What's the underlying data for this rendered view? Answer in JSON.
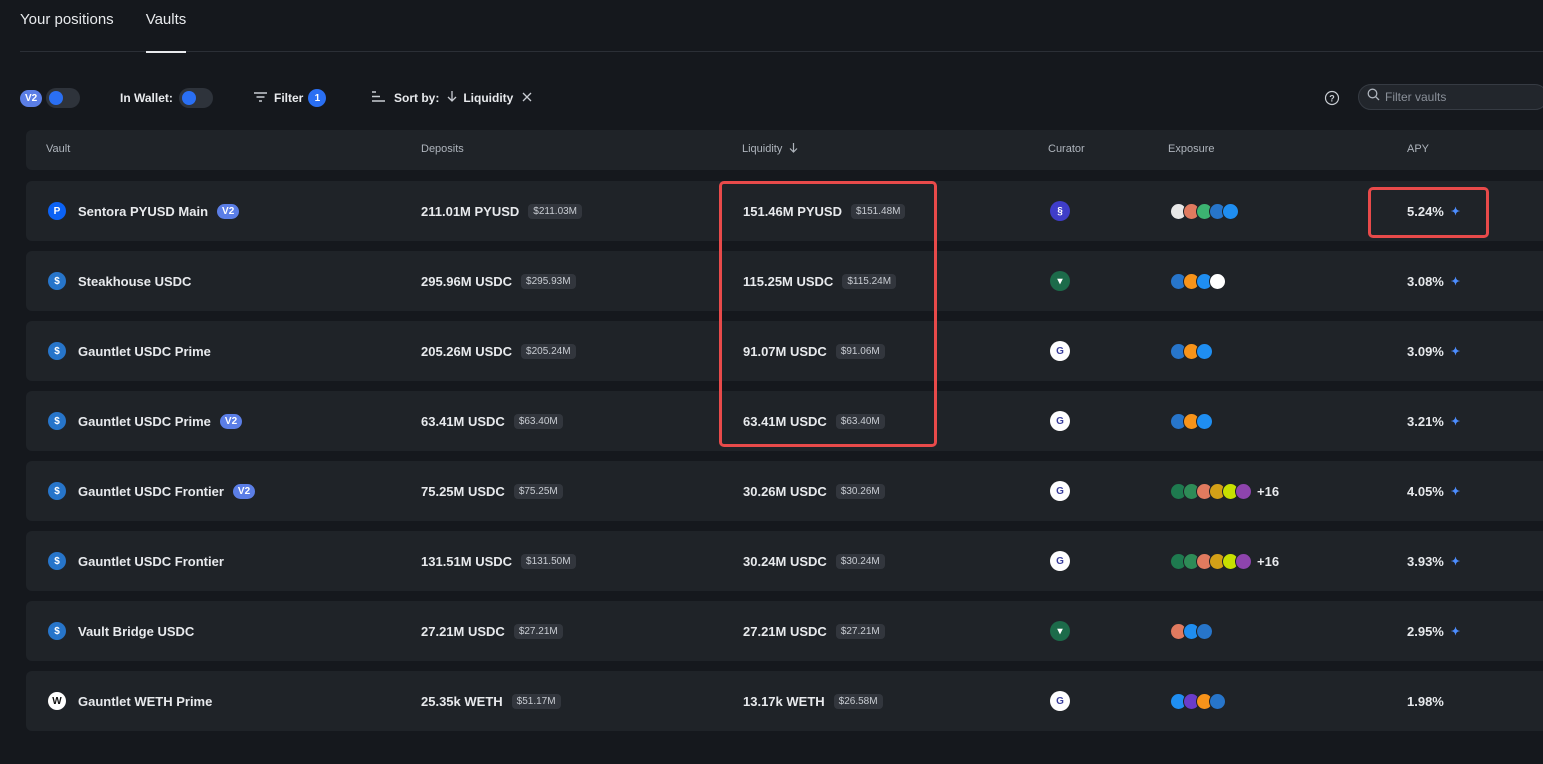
{
  "tabs": [
    "Your positions",
    "Vaults"
  ],
  "toolbar": {
    "v2_label": "V2",
    "in_wallet_label": "In Wallet:",
    "filter_label": "Filter",
    "filter_count": "1",
    "sort_label": "Sort by:",
    "sort_value": "Liquidity",
    "search_placeholder": "Filter vaults"
  },
  "columns": {
    "vault": "Vault",
    "deposits": "Deposits",
    "liquidity": "Liquidity",
    "curator": "Curator",
    "exposure": "Exposure",
    "apy": "APY"
  },
  "colors": {
    "accent": "#2a6ff3",
    "v2_badge": "#5b7ee6",
    "highlight": "#e84a4a",
    "usdc": "#2775ca",
    "pyusd": "#0b62f5",
    "weth": "#ffffff"
  },
  "rows": [
    {
      "vault": "Sentora PYUSD Main",
      "v2": "V2",
      "asset": "pyusd",
      "deposits": "211.01M PYUSD",
      "deposits_usd": "$211.03M",
      "liquidity": "151.46M PYUSD",
      "liquidity_usd": "$151.48M",
      "curator": "sentora",
      "exposure": [
        "#e8e8e8",
        "#e07a5f",
        "#3cb371",
        "#2775ca",
        "#1f8ef1"
      ],
      "exposure_more": "",
      "apy": "5.24%",
      "sparkle": true
    },
    {
      "vault": "Steakhouse USDC",
      "v2": "",
      "asset": "usdc",
      "deposits": "295.96M USDC",
      "deposits_usd": "$295.93M",
      "liquidity": "115.25M USDC",
      "liquidity_usd": "$115.24M",
      "curator": "steakhouse",
      "exposure": [
        "#2775ca",
        "#f7931a",
        "#1f8ef1",
        "#ffffff"
      ],
      "exposure_more": "",
      "apy": "3.08%",
      "sparkle": true
    },
    {
      "vault": "Gauntlet USDC Prime",
      "v2": "",
      "asset": "usdc",
      "deposits": "205.26M USDC",
      "deposits_usd": "$205.24M",
      "liquidity": "91.07M USDC",
      "liquidity_usd": "$91.06M",
      "curator": "gauntlet",
      "exposure": [
        "#2775ca",
        "#f7931a",
        "#1f8ef1"
      ],
      "exposure_more": "",
      "apy": "3.09%",
      "sparkle": true
    },
    {
      "vault": "Gauntlet USDC Prime",
      "v2": "V2",
      "asset": "usdc",
      "deposits": "63.41M USDC",
      "deposits_usd": "$63.40M",
      "liquidity": "63.41M USDC",
      "liquidity_usd": "$63.40M",
      "curator": "gauntlet",
      "exposure": [
        "#2775ca",
        "#f7931a",
        "#1f8ef1"
      ],
      "exposure_more": "",
      "apy": "3.21%",
      "sparkle": true
    },
    {
      "vault": "Gauntlet USDC Frontier",
      "v2": "V2",
      "asset": "usdc",
      "deposits": "75.25M USDC",
      "deposits_usd": "$75.25M",
      "liquidity": "30.26M USDC",
      "liquidity_usd": "$30.26M",
      "curator": "gauntlet",
      "exposure": [
        "#1e7a4f",
        "#2e8b57",
        "#e07a5f",
        "#d4a017",
        "#c8e000",
        "#8e44ad"
      ],
      "exposure_more": "+16",
      "apy": "4.05%",
      "sparkle": true
    },
    {
      "vault": "Gauntlet USDC Frontier",
      "v2": "",
      "asset": "usdc",
      "deposits": "131.51M USDC",
      "deposits_usd": "$131.50M",
      "liquidity": "30.24M USDC",
      "liquidity_usd": "$30.24M",
      "curator": "gauntlet",
      "exposure": [
        "#1e7a4f",
        "#2e8b57",
        "#e07a5f",
        "#d4a017",
        "#c8e000",
        "#8e44ad"
      ],
      "exposure_more": "+16",
      "apy": "3.93%",
      "sparkle": true
    },
    {
      "vault": "Vault Bridge USDC",
      "v2": "",
      "asset": "usdc",
      "deposits": "27.21M USDC",
      "deposits_usd": "$27.21M",
      "liquidity": "27.21M USDC",
      "liquidity_usd": "$27.21M",
      "curator": "steakhouse",
      "exposure": [
        "#e07a5f",
        "#1f8ef1",
        "#2775ca"
      ],
      "exposure_more": "",
      "apy": "2.95%",
      "sparkle": true
    },
    {
      "vault": "Gauntlet WETH Prime",
      "v2": "",
      "asset": "weth",
      "deposits": "25.35k WETH",
      "deposits_usd": "$51.17M",
      "liquidity": "13.17k WETH",
      "liquidity_usd": "$26.58M",
      "curator": "gauntlet",
      "exposure": [
        "#1f8ef1",
        "#6a3cc9",
        "#f7931a",
        "#2775ca"
      ],
      "exposure_more": "",
      "apy": "1.98%",
      "sparkle": false
    }
  ]
}
